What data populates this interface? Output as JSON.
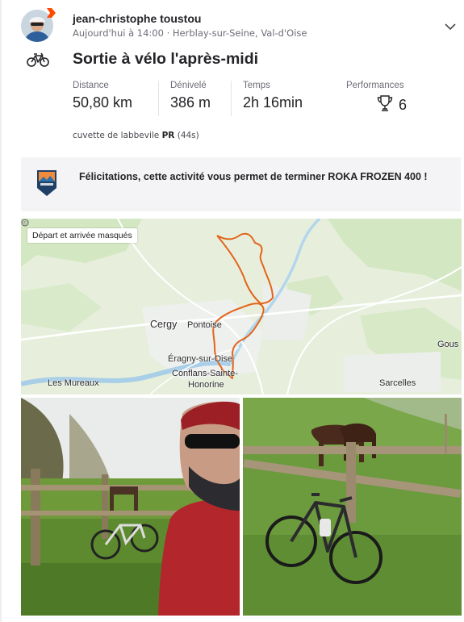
{
  "athlete": {
    "name": "jean-christophe toustou",
    "meta": "Aujourd'hui à 14:00 · Herblay-sur-Seine, Val-d'Oise"
  },
  "activity": {
    "sport_icon": "bike-icon",
    "title": "Sortie à vélo l'après-midi"
  },
  "stats": [
    {
      "label": "Distance",
      "value": "50,80 km"
    },
    {
      "label": "Dénivelé",
      "value": "386 m"
    },
    {
      "label": "Temps",
      "value": "2h 16min"
    },
    {
      "label": "Performances",
      "value": "6",
      "icon": "trophy-icon"
    }
  ],
  "segment": {
    "name": "cuvette de labbevile",
    "badge": "PR",
    "time": "(44s)"
  },
  "achievement": {
    "text": "Félicitations, cette activité vous permet de terminer ROKA FROZEN 400 !",
    "badge_icon": "challenge-badge-icon"
  },
  "map": {
    "chip": "Départ et arrivée masqués",
    "places": [
      "Cergy",
      "Pontoise",
      "Éragny-sur-Oise",
      "Conflans-Sainte-",
      "Honorine",
      "Les Mureaux",
      "Sarcelles",
      "Gous"
    ],
    "route_color": "#e3641a"
  },
  "photos": [
    "bike-by-fence-selfie-photo",
    "bike-horses-field-photo"
  ],
  "colors": {
    "accent": "#fc4c02",
    "text": "#242428",
    "muted": "#6d6d78"
  }
}
